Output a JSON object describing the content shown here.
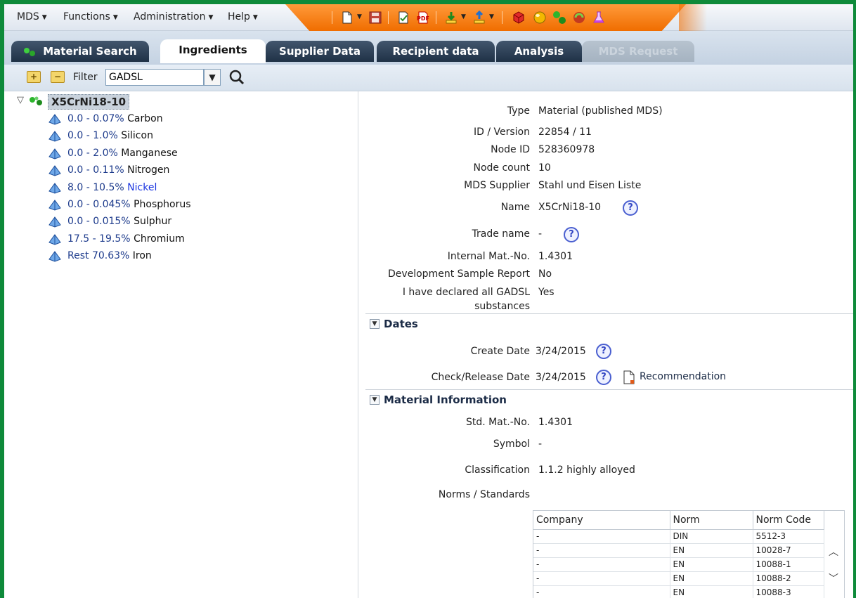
{
  "menubar": {
    "menus": [
      "MDS",
      "Functions",
      "Administration",
      "Help"
    ],
    "toolbar_icons": [
      "new-document-icon",
      "save-icon",
      "edit-check-icon",
      "pdf-icon",
      "download-icon",
      "upload-icon",
      "cube-icon",
      "sphere-icon",
      "molecule-icon",
      "recycle-icon",
      "flask-icon"
    ]
  },
  "tabs": [
    {
      "label": "Material Search",
      "state": "normal"
    },
    {
      "label": "Ingredients",
      "state": "active"
    },
    {
      "label": "Supplier Data",
      "state": "normal"
    },
    {
      "label": "Recipient data",
      "state": "normal"
    },
    {
      "label": "Analysis",
      "state": "normal"
    },
    {
      "label": "MDS Request",
      "state": "disabled"
    }
  ],
  "filter": {
    "label": "Filter",
    "value": "GADSL"
  },
  "tree": {
    "root": "X5CrNi18-10",
    "items": [
      {
        "pct": "0.0 - 0.07%",
        "name": "Carbon",
        "link": false
      },
      {
        "pct": "0.0 - 1.0%",
        "name": "Silicon",
        "link": false
      },
      {
        "pct": "0.0 - 2.0%",
        "name": "Manganese",
        "link": false
      },
      {
        "pct": "0.0 - 0.11%",
        "name": "Nitrogen",
        "link": false
      },
      {
        "pct": "8.0 - 10.5%",
        "name": "Nickel",
        "link": true
      },
      {
        "pct": "0.0 - 0.045%",
        "name": "Phosphorus",
        "link": false
      },
      {
        "pct": "0.0 - 0.015%",
        "name": "Sulphur",
        "link": false
      },
      {
        "pct": "17.5 - 19.5%",
        "name": "Chromium",
        "link": false
      },
      {
        "pct": "Rest 70.63%",
        "name": "Iron",
        "link": false
      }
    ]
  },
  "details": {
    "type_label": "Type",
    "type_value": "Material (published MDS)",
    "id_label": "ID / Version",
    "id_value": "22854 / 11",
    "node_id_label": "Node ID",
    "node_id_value": "528360978",
    "node_count_label": "Node count",
    "node_count_value": "10",
    "supplier_label": "MDS Supplier",
    "supplier_value": "Stahl und Eisen Liste",
    "name_label": "Name",
    "name_value": "X5CrNi18-10",
    "trade_label": "Trade name",
    "trade_value": "-",
    "internal_label": "Internal Mat.-No.",
    "internal_value": "1.4301",
    "devsample_label": "Development Sample Report",
    "devsample_value": "No",
    "gadsl_label_1": "I have declared all GADSL",
    "gadsl_label_2": "substances",
    "gadsl_value": "Yes"
  },
  "dates": {
    "title": "Dates",
    "create_label": "Create Date",
    "create_value": "3/24/2015",
    "check_label": "Check/Release Date",
    "check_value": "3/24/2015",
    "recommendation": "Recommendation"
  },
  "material_info": {
    "title": "Material Information",
    "std_label": "Std. Mat.-No.",
    "std_value": "1.4301",
    "symbol_label": "Symbol",
    "symbol_value": "-",
    "class_label": "Classification",
    "class_value": "1.1.2 highly alloyed",
    "norms_label": "Norms / Standards"
  },
  "norms_table": {
    "headers": [
      "Company",
      "Norm",
      "Norm Code"
    ],
    "rows": [
      [
        "-",
        "DIN",
        "5512-3"
      ],
      [
        "-",
        "EN",
        "10028-7"
      ],
      [
        "-",
        "EN",
        "10088-1"
      ],
      [
        "-",
        "EN",
        "10088-2"
      ],
      [
        "-",
        "EN",
        "10088-3"
      ]
    ]
  },
  "colors": {
    "frame": "#0e8a3a",
    "toolbar": "#f06d00",
    "tab": "#1f3146",
    "link": "#1a35e0"
  }
}
